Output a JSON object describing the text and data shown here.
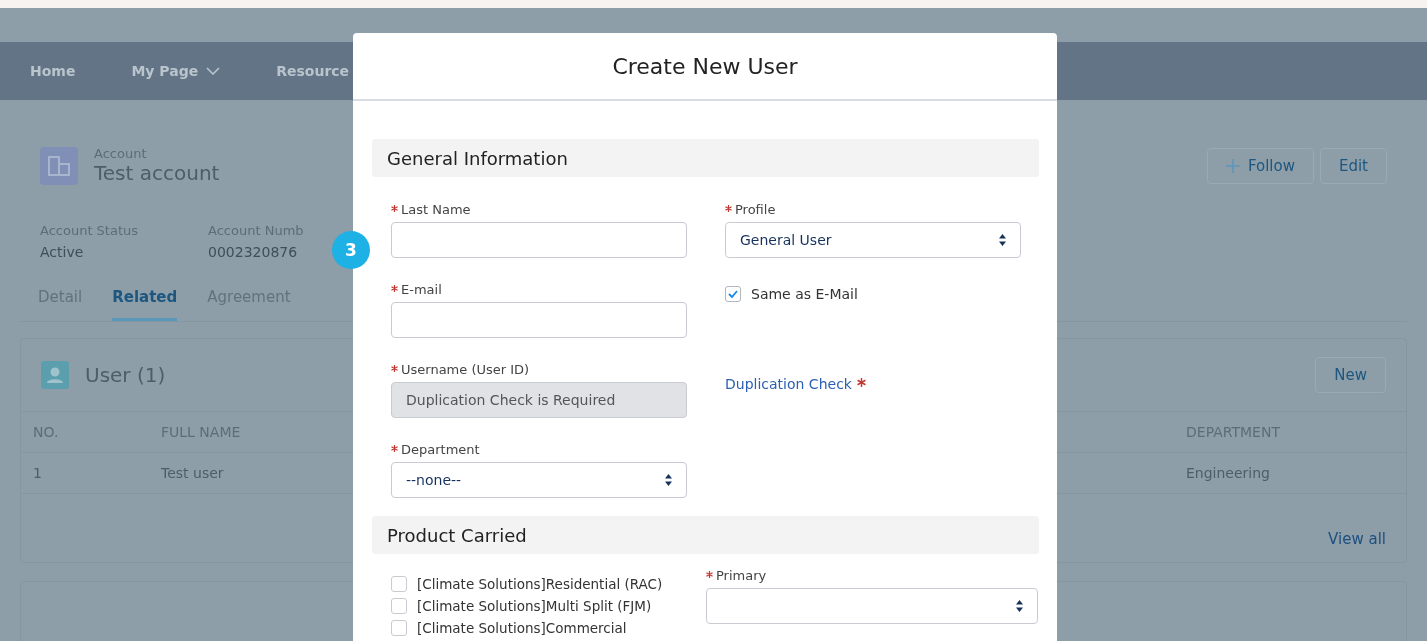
{
  "nav": [
    {
      "label": "Home",
      "dropdown": false
    },
    {
      "label": "My Page",
      "dropdown": true
    },
    {
      "label": "Resource",
      "dropdown": false
    }
  ],
  "account": {
    "type_label": "Account",
    "name": "Test account",
    "follow": "Follow",
    "edit": "Edit"
  },
  "fields": [
    {
      "label": "Account Status",
      "value": "Active"
    },
    {
      "label": "Account Numb",
      "value": "0002320876"
    }
  ],
  "tabs": [
    {
      "label": "Detail",
      "selected": false
    },
    {
      "label": "Related",
      "selected": true
    },
    {
      "label": "Agreement",
      "selected": false
    }
  ],
  "related": {
    "title": "User (1)",
    "button": "New",
    "columns": [
      "NO.",
      "FULL NAME",
      "DEPARTMENT"
    ],
    "rows": [
      [
        "1",
        "Test user",
        "Engineering"
      ]
    ],
    "link": "View all"
  },
  "modal": {
    "title": "Create New User",
    "step_badge": "3",
    "sections": [
      {
        "title": "General Information",
        "rows": [
          {
            "left": {
              "kind": "text",
              "label": "Last Name",
              "required": true
            },
            "right": {
              "kind": "select",
              "label": "Profile",
              "required": true,
              "value": "General User"
            }
          },
          {
            "left": {
              "kind": "text",
              "label": "E-mail",
              "required": true
            },
            "right": {
              "kind": "checkbox",
              "label": "Same as E-Mail",
              "checked": true
            }
          },
          {
            "left": {
              "kind": "readonly",
              "label": "Username (User ID)",
              "required": true,
              "value": "Duplication Check is Required"
            },
            "right": {
              "kind": "link",
              "label": "Duplication Check",
              "required": true
            }
          },
          {
            "left": {
              "kind": "select",
              "label": "Department",
              "required": true,
              "value": "--none--"
            }
          }
        ]
      },
      {
        "title": "Product Carried",
        "products": [
          {
            "label": "[Climate Solutions]Residential (RAC)",
            "checked": false
          },
          {
            "label": "[Climate Solutions]Multi Split (FJM)",
            "checked": false
          },
          {
            "label": "[Climate Solutions]Commercial",
            "checked": false
          }
        ],
        "primary": {
          "label": "Primary",
          "required": true
        }
      }
    ]
  }
}
